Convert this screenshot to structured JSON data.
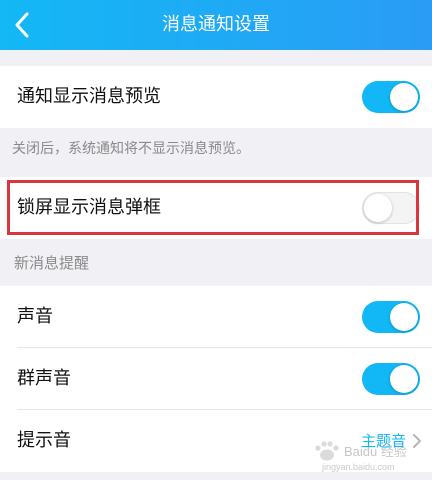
{
  "header": {
    "title": "消息通知设置",
    "background_color": "#1aaef5",
    "back_icon": "chevron-left-icon"
  },
  "settings": {
    "preview_label": "通知显示消息预览",
    "preview_on": true,
    "preview_hint": "关闭后，系统通知将不显示消息预览。",
    "lockscreen_label": "锁屏显示消息弹框",
    "lockscreen_on": false
  },
  "new_message": {
    "section_title": "新消息提醒",
    "sound_label": "声音",
    "sound_on": true,
    "group_sound_label": "群声音",
    "group_sound_on": true,
    "tone_label": "提示音",
    "tone_value": "主题音"
  },
  "colors": {
    "toggle_on": "#12b7f5",
    "highlight_border": "#d8383d",
    "page_background": "#f0f0f5"
  },
  "watermark": {
    "text": "Baidu 经验",
    "url_text": "jingyan.baidu.com"
  }
}
